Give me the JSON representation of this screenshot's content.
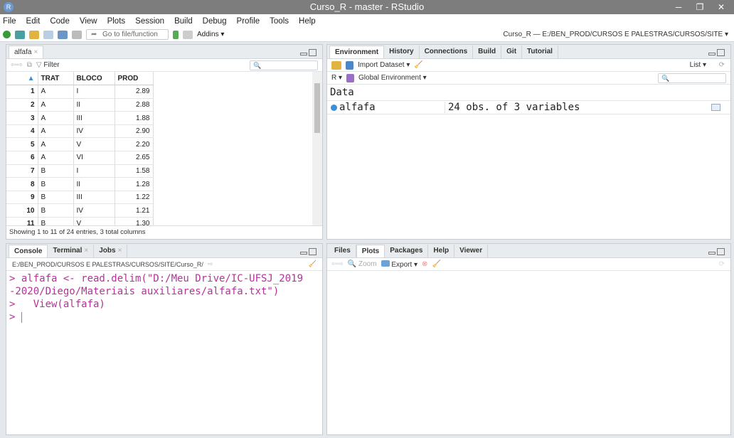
{
  "window": {
    "title": "Curso_R - master - RStudio",
    "logo": "R",
    "minimize": "─",
    "restore": "❐",
    "close": "✕"
  },
  "menu": [
    "File",
    "Edit",
    "Code",
    "View",
    "Plots",
    "Session",
    "Build",
    "Debug",
    "Profile",
    "Tools",
    "Help"
  ],
  "toolbar": {
    "goto_placeholder": "Go to file/function",
    "addins": "Addins ▾",
    "project": "Curso_R — E:/BEN_PROD/CURSOS E PALESTRAS/CURSOS/SITE ▾"
  },
  "viewer": {
    "tab": "alfafa",
    "tab_close": "×",
    "filter": "Filter",
    "columns": [
      "TRAT",
      "BLOCO",
      "PROD"
    ],
    "rows": [
      [
        "1",
        "A",
        "I",
        "2.89"
      ],
      [
        "2",
        "A",
        "II",
        "2.88"
      ],
      [
        "3",
        "A",
        "III",
        "1.88"
      ],
      [
        "4",
        "A",
        "IV",
        "2.90"
      ],
      [
        "5",
        "A",
        "V",
        "2.20"
      ],
      [
        "6",
        "A",
        "VI",
        "2.65"
      ],
      [
        "7",
        "B",
        "I",
        "1.58"
      ],
      [
        "8",
        "B",
        "II",
        "1.28"
      ],
      [
        "9",
        "B",
        "III",
        "1.22"
      ],
      [
        "10",
        "B",
        "IV",
        "1.21"
      ],
      [
        "11",
        "B",
        "V",
        "1.30"
      ]
    ],
    "footer": "Showing 1 to 11 of 24 entries, 3 total columns"
  },
  "env": {
    "tabs": [
      "Environment",
      "History",
      "Connections",
      "Build",
      "Git",
      "Tutorial"
    ],
    "active": "Environment",
    "import": "Import Dataset ▾",
    "list": "List ▾",
    "lang": "R ▾",
    "scope": "Global Environment ▾",
    "section": "Data",
    "items": [
      {
        "name": "alfafa",
        "value": "24 obs. of 3 variables"
      }
    ]
  },
  "console": {
    "tabs": [
      "Console",
      "Terminal",
      "Jobs"
    ],
    "active": "Console",
    "close": "×",
    "path": "E:/BEN_PROD/CURSOS E PALESTRAS/CURSOS/SITE/Curso_R/",
    "lines": [
      "> alfafa <- read.delim(\"D:/Meu Drive/IC-UFSJ_2019",
      "-2020/Diego/Materiais auxiliares/alfafa.txt\")",
      ">   View(alfafa)",
      ">"
    ]
  },
  "files": {
    "tabs": [
      "Files",
      "Plots",
      "Packages",
      "Help",
      "Viewer"
    ],
    "active": "Plots",
    "zoom": "Zoom",
    "export": "Export ▾"
  }
}
